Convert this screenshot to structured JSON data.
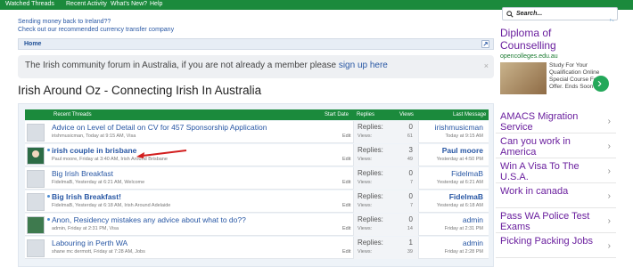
{
  "topnav": {
    "items": [
      "Watched Threads",
      "Recent Activity",
      "What's New?",
      "Help"
    ]
  },
  "promo": {
    "line1": "Sending money back to Ireland??",
    "line2": "Check out our recommended currency transfer company"
  },
  "search": {
    "placeholder": "Search..."
  },
  "breadcrumb": {
    "home": "Home"
  },
  "notice": {
    "text": "The Irish community forum in Australia, if you are not already a member please ",
    "link": "sign up here",
    "close": "×"
  },
  "page_title": "Irish Around Oz - Connecting Irish In Australia",
  "table": {
    "headers": {
      "recent": "Recent Threads",
      "start": "Start Date",
      "replies": "Replies",
      "views": "Views",
      "last": "Last Message"
    },
    "replies_label": "Replies:",
    "views_label": "Views:",
    "edit_label": "Edit",
    "rows": [
      {
        "title": "Advice on Level of Detail on CV for 457 Sponsorship Application",
        "meta": "irishmusicman, Today at 9:15 AM, Visa",
        "replies": "0",
        "views": "61",
        "last_user": "irishmusicman",
        "last_time": "Today at 9:15 AM"
      },
      {
        "title": "irish couple in brisbane",
        "meta": "Paul moore, Friday at 3:40 AM, Irish Around Brisbane",
        "replies": "3",
        "views": "49",
        "last_user": "Paul moore",
        "last_time": "Yesterday at 4:50 PM"
      },
      {
        "title": "Big Irish Breakfast",
        "meta": "FidelmaB, Yesterday at 6:21 AM, Welcome",
        "replies": "0",
        "views": "7",
        "last_user": "FidelmaB",
        "last_time": "Yesterday at 6:21 AM"
      },
      {
        "title": "Big Irish Breakfast!",
        "meta": "FidelmaB, Yesterday at 6:18 AM, Irish Around Adelaide",
        "replies": "0",
        "views": "7",
        "last_user": "FidelmaB",
        "last_time": "Yesterday at 6:18 AM"
      },
      {
        "title": "Anon, Residency mistakes any advice about what to do??",
        "meta": "admin, Friday at 2:31 PM, Visa",
        "replies": "0",
        "views": "14",
        "last_user": "admin",
        "last_time": "Friday at 2:31 PM"
      },
      {
        "title": "Labouring in Perth WA",
        "meta": "shane mc dermott, Friday at 7:28 AM, Jobs",
        "replies": "1",
        "views": "39",
        "last_user": "admin",
        "last_time": "Friday at 2:28 PM"
      }
    ]
  },
  "ad_top": {
    "headline": "Diploma of Counselling",
    "url": "opencolleges.edu.au",
    "body": "Study For Your Qualification Online Special Course Fee Offer. Ends Soon"
  },
  "ads_list": [
    "AMACS Migration Service",
    "Can you work in America",
    "Win A Visa To The U.S.A.",
    "Work in canada",
    "Pass WA Police Test Exams",
    "Picking Packing Jobs"
  ],
  "colors": {
    "nav_green": "#1b8a3c",
    "link_blue": "#2857a4",
    "ad_purple": "#6a1f9e",
    "annotation_red": "#d21f1f"
  }
}
